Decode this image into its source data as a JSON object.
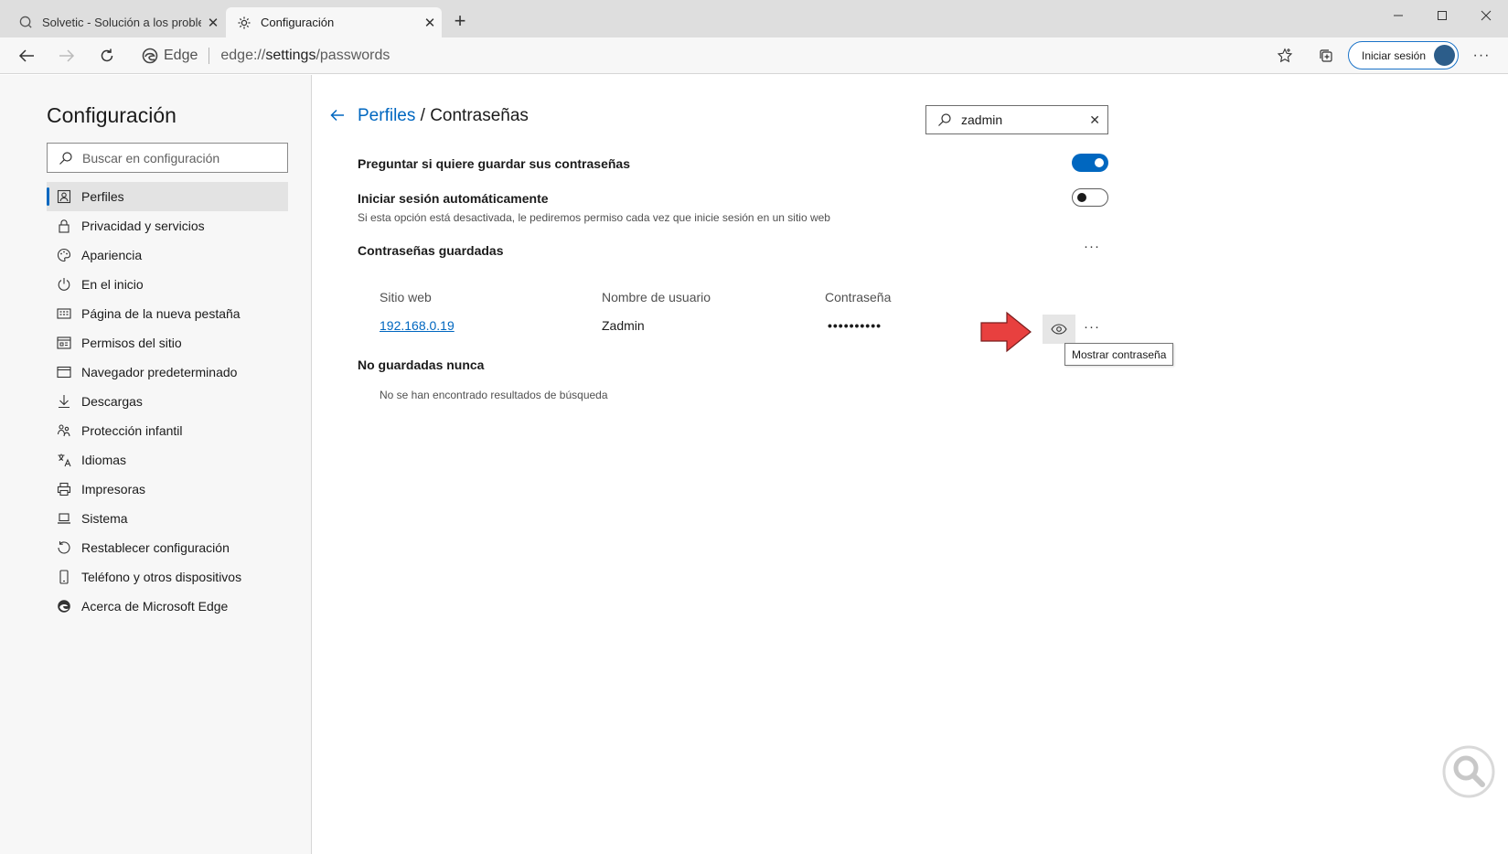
{
  "tabs": [
    {
      "title": "Solvetic - Solución a los problem",
      "icon": "solvetic-favicon-icon",
      "active": false
    },
    {
      "title": "Configuración",
      "icon": "gear-icon",
      "active": true
    }
  ],
  "address_bar": {
    "site_label": "Edge",
    "url_prefix": "edge://",
    "url_host": "settings",
    "url_path": "/passwords",
    "signin_label": "Iniciar sesión"
  },
  "sidebar": {
    "title": "Configuración",
    "search_placeholder": "Buscar en configuración",
    "items": [
      {
        "label": "Perfiles",
        "icon": "profile-icon",
        "active": true
      },
      {
        "label": "Privacidad y servicios",
        "icon": "lock-icon"
      },
      {
        "label": "Apariencia",
        "icon": "palette-icon"
      },
      {
        "label": "En el inicio",
        "icon": "power-icon"
      },
      {
        "label": "Página de la nueva pestaña",
        "icon": "new-tab-page-icon"
      },
      {
        "label": "Permisos del sitio",
        "icon": "site-permissions-icon"
      },
      {
        "label": "Navegador predeterminado",
        "icon": "browser-window-icon"
      },
      {
        "label": "Descargas",
        "icon": "download-icon"
      },
      {
        "label": "Protección infantil",
        "icon": "family-icon"
      },
      {
        "label": "Idiomas",
        "icon": "languages-icon"
      },
      {
        "label": "Impresoras",
        "icon": "printer-icon"
      },
      {
        "label": "Sistema",
        "icon": "laptop-icon"
      },
      {
        "label": "Restablecer configuración",
        "icon": "reset-icon"
      },
      {
        "label": "Teléfono y otros dispositivos",
        "icon": "phone-icon"
      },
      {
        "label": "Acerca de Microsoft Edge",
        "icon": "edge-logo-icon"
      }
    ]
  },
  "main": {
    "breadcrumb_parent": "Perfiles",
    "breadcrumb_sep": " / ",
    "breadcrumb_current": "Contraseñas",
    "search_value": "zadmin",
    "offer_save_label": "Preguntar si quiere guardar sus contraseñas",
    "offer_save_on": true,
    "autosignin_label": "Iniciar sesión automáticamente",
    "autosignin_on": false,
    "autosignin_desc": "Si esta opción está desactivada, le pediremos permiso cada vez que inicie sesión en un sitio web",
    "saved_header": "Contraseñas guardadas",
    "columns": {
      "site": "Sitio web",
      "username": "Nombre de usuario",
      "password": "Contraseña"
    },
    "saved_rows": [
      {
        "site": "192.168.0.19",
        "username": "Zadmin",
        "password": "••••••••••"
      }
    ],
    "show_password_tooltip": "Mostrar contraseña",
    "never_saved_header": "No guardadas nunca",
    "never_saved_empty": "No se han encontrado resultados de búsqueda"
  },
  "colors": {
    "accent": "#0067c0",
    "annotation_arrow": "#e8403f"
  }
}
